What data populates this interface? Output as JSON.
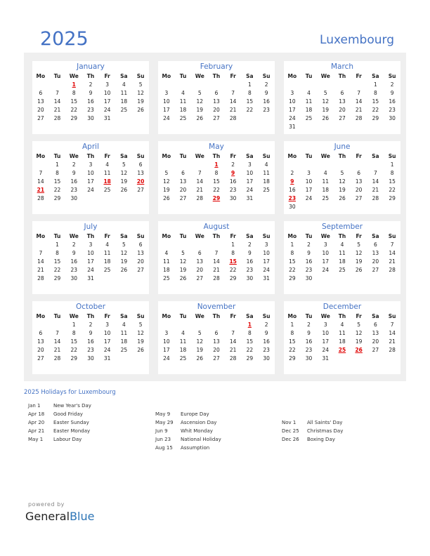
{
  "header": {
    "year": "2025",
    "country": "Luxembourg"
  },
  "weekdays": [
    "Mo",
    "Tu",
    "We",
    "Th",
    "Fr",
    "Sa",
    "Su"
  ],
  "months": [
    {
      "name": "January",
      "offset": 2,
      "days": 31,
      "holidays": [
        1
      ]
    },
    {
      "name": "February",
      "offset": 5,
      "days": 28,
      "holidays": []
    },
    {
      "name": "March",
      "offset": 5,
      "days": 31,
      "holidays": []
    },
    {
      "name": "April",
      "offset": 1,
      "days": 30,
      "holidays": [
        18,
        20,
        21
      ]
    },
    {
      "name": "May",
      "offset": 3,
      "days": 31,
      "holidays": [
        1,
        9,
        29
      ]
    },
    {
      "name": "June",
      "offset": 6,
      "days": 30,
      "holidays": [
        9,
        23
      ]
    },
    {
      "name": "July",
      "offset": 1,
      "days": 31,
      "holidays": []
    },
    {
      "name": "August",
      "offset": 4,
      "days": 31,
      "holidays": [
        15
      ]
    },
    {
      "name": "September",
      "offset": 0,
      "days": 30,
      "holidays": []
    },
    {
      "name": "October",
      "offset": 2,
      "days": 31,
      "holidays": []
    },
    {
      "name": "November",
      "offset": 5,
      "days": 30,
      "holidays": [
        1
      ]
    },
    {
      "name": "December",
      "offset": 0,
      "days": 31,
      "holidays": [
        25,
        26
      ]
    }
  ],
  "holidays_title": "2025 Holidays for Luxembourg",
  "holiday_columns": [
    [
      {
        "date": "Jan 1",
        "name": "New Year's Day"
      },
      {
        "date": "Apr 18",
        "name": "Good Friday"
      },
      {
        "date": "Apr 20",
        "name": "Easter Sunday"
      },
      {
        "date": "Apr 21",
        "name": "Easter Monday"
      },
      {
        "date": "May 1",
        "name": "Labour Day"
      }
    ],
    [
      {
        "date": "",
        "name": ""
      },
      {
        "date": "May 9",
        "name": "Europe Day"
      },
      {
        "date": "May 29",
        "name": "Ascension Day"
      },
      {
        "date": "Jun 9",
        "name": "Whit Monday"
      },
      {
        "date": "Jun 23",
        "name": "National Holiday"
      },
      {
        "date": "Aug 15",
        "name": "Assumption"
      }
    ],
    [
      {
        "date": "",
        "name": ""
      },
      {
        "date": "",
        "name": ""
      },
      {
        "date": "Nov 1",
        "name": "All Saints' Day"
      },
      {
        "date": "Dec 25",
        "name": "Christmas Day"
      },
      {
        "date": "Dec 26",
        "name": "Boxing Day"
      }
    ]
  ],
  "footer": {
    "powered": "powered by",
    "brand_a": "General",
    "brand_b": "Blue"
  }
}
